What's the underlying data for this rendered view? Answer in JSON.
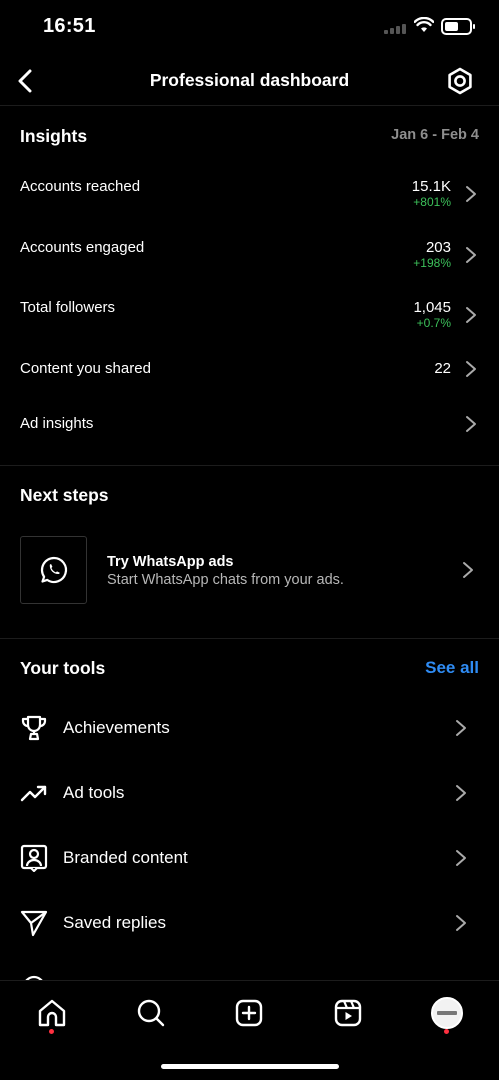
{
  "status": {
    "time": "16:51",
    "battery_level": 0.55
  },
  "header": {
    "title": "Professional dashboard"
  },
  "insights": {
    "title": "Insights",
    "date_range": "Jan 6 - Feb 4",
    "rows": [
      {
        "label": "Accounts reached",
        "value": "15.1K",
        "change": "+801%"
      },
      {
        "label": "Accounts engaged",
        "value": "203",
        "change": "+198%"
      },
      {
        "label": "Total followers",
        "value": "1,045",
        "change": "+0.7%"
      },
      {
        "label": "Content you shared",
        "value": "22",
        "change": ""
      },
      {
        "label": "Ad insights",
        "value": "",
        "change": ""
      }
    ]
  },
  "next_steps": {
    "title": "Next steps",
    "card": {
      "title": "Try WhatsApp ads",
      "subtitle": "Start WhatsApp chats from your ads.",
      "icon": "whatsapp-icon"
    }
  },
  "tools": {
    "title": "Your tools",
    "see_all": "See all",
    "items": [
      {
        "label": "Achievements",
        "icon": "trophy-icon"
      },
      {
        "label": "Ad tools",
        "icon": "trending-up-icon"
      },
      {
        "label": "Branded content",
        "icon": "person-badge-icon"
      },
      {
        "label": "Saved replies",
        "icon": "send-icon"
      }
    ]
  },
  "tab_bar": {
    "tabs": [
      {
        "name": "home",
        "icon": "home-icon",
        "notification_dot": true
      },
      {
        "name": "search",
        "icon": "search-icon",
        "notification_dot": false
      },
      {
        "name": "create",
        "icon": "plus-square-icon",
        "notification_dot": false
      },
      {
        "name": "reels",
        "icon": "reels-icon",
        "notification_dot": false
      },
      {
        "name": "profile",
        "icon": "avatar",
        "notification_dot": true
      }
    ]
  },
  "colors": {
    "background": "#000000",
    "accent": "#2f8cf4",
    "positive": "#3cc05a",
    "notification": "#ff3040",
    "muted": "#8e8e8e"
  }
}
